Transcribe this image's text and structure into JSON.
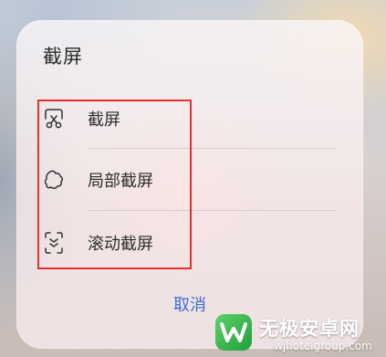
{
  "dialog": {
    "title": "截屏",
    "options": [
      {
        "label": "截屏",
        "icon": "screenshot-scissors-icon"
      },
      {
        "label": "局部截屏",
        "icon": "partial-screenshot-icon"
      },
      {
        "label": "滚动截屏",
        "icon": "scrolling-screenshot-icon"
      }
    ],
    "cancel_label": "取消"
  },
  "colors": {
    "accent": "#3a6fd8",
    "highlight": "#e0312f"
  },
  "watermark": {
    "title": "无极安卓网",
    "url": "wjhotelgroup.com"
  }
}
